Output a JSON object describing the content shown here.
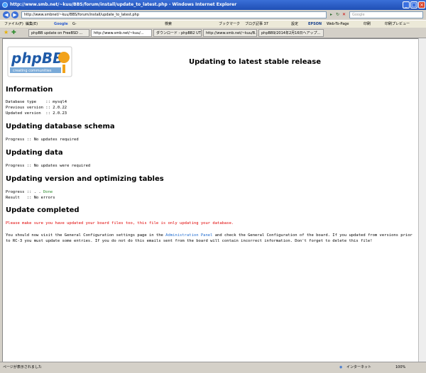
{
  "window": {
    "title": "http://www.smb.net/~kuu/BBS/forum/install/update_to_latest.php - Windows Internet Explorer",
    "minimize": "_",
    "maximize": "□",
    "close": "×"
  },
  "address_bar": {
    "back": "◀",
    "forward": "▶",
    "url": "http://www.smbnet/~kuu/BBS/forum/install/update_to_latest.php",
    "go": "▸",
    "refresh": "↻",
    "stop": "✕",
    "search_placeholder": "Google"
  },
  "menu": {
    "file": "ファイル(F)",
    "edit": "編集(E)",
    "google": "Google",
    "g_label": "G-",
    "search_label": "検索",
    "bookmarks": "ブックマーク",
    "blog": "ブログ記事 37",
    "settings": "設定",
    "epson": "EPSON",
    "web_to_page": "Web-To-Page",
    "print": "印刷",
    "print_preview": "印刷プレビュー"
  },
  "tabs": [
    {
      "label": "phpBB update on FreeBSD ..."
    },
    {
      "label": "http://www.smb.net/~kuu/..."
    },
    {
      "label": "ダウンロード - phpBB2 UTF-..."
    },
    {
      "label": "http://www.smb.net/~kuu/B..."
    },
    {
      "label": "phpBB9/2014年2月16日ヘアップ..."
    }
  ],
  "page": {
    "logo_text": "phpBB",
    "logo_tagline": "creating communities",
    "title": "Updating to latest stable release",
    "information": {
      "heading": "Information",
      "lines": [
        "Database type    :: mysql4",
        "Previous version :: 2.0.22",
        "Updated version  :: 2.0.23"
      ]
    },
    "schema": {
      "heading": "Updating database schema",
      "line": "Progress :: No updates required"
    },
    "data_section": {
      "heading": "Updating data",
      "line": "Progress :: No updates were required"
    },
    "version": {
      "heading": "Updating version and optimizing tables",
      "progress_label": "Progress :: ",
      "progress_dots": ". . ",
      "progress_done": "Done",
      "result_line": "Result   :: No errors"
    },
    "completed": {
      "heading": "Update completed",
      "warning": "Please make sure you have updated your board files too, this file is only updating your database.",
      "para_before_link": "You should now visit the General Configuration settings page in the ",
      "link": "Administration Panel",
      "para_after_link": " and check the General Configuration of the board. If you updated from versions prior to RC-3 you must update some entries. If you do not do this emails sent from the board will contain incorrect information. Don't forget to delete this file!"
    }
  },
  "status": {
    "left": "ページが表示されました",
    "zone": "インターネット",
    "zoom": "100%"
  }
}
